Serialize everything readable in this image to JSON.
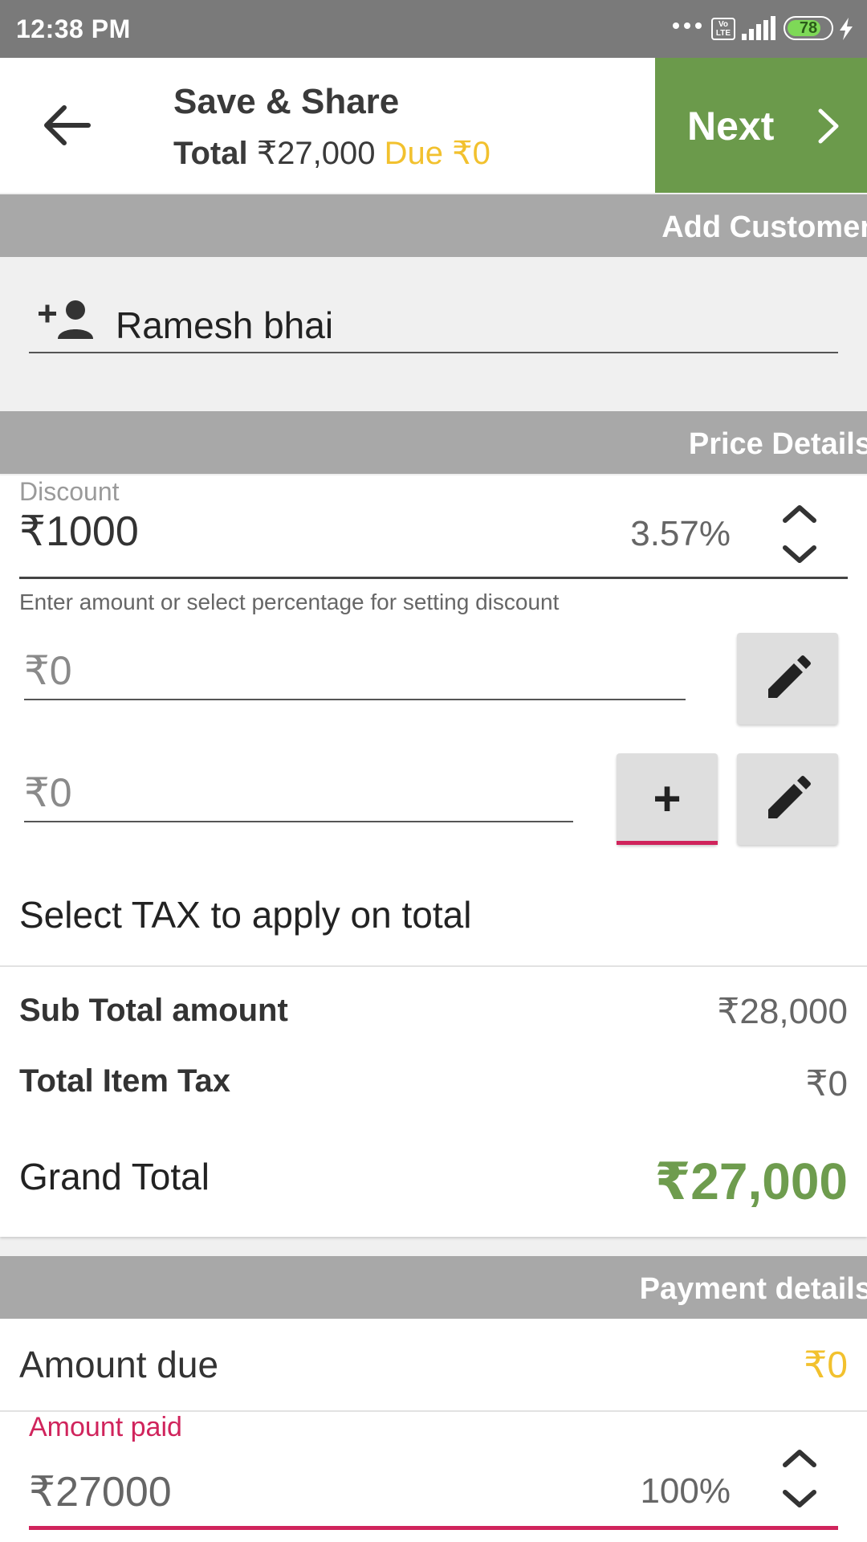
{
  "status_bar": {
    "time": "12:38 PM",
    "network_badge": "Vo LTE",
    "battery_level": "78",
    "battery_fraction": 0.78,
    "battery_color": "#7ed957"
  },
  "app_bar": {
    "back_icon": "arrow-back-icon",
    "title": "Save & Share",
    "total_label": "Total",
    "total_value": "₹27,000",
    "due_text": "Due ₹0",
    "next_label": "Next",
    "next_icon": "chevron-right-icon",
    "accent_color": "#6b9a4b",
    "due_color": "#f2c12e"
  },
  "customer_section": {
    "header": "Add Customer",
    "add_icon": "person-add-icon",
    "customer_name": "Ramesh bhai"
  },
  "price_section": {
    "header": "Price Details",
    "discount": {
      "label": "Discount",
      "value": "₹1000",
      "percent": "3.57%",
      "helper": "Enter amount or select percentage for setting discount"
    },
    "extra_charge_1": {
      "value": "₹0",
      "edit_icon": "pencil-icon"
    },
    "extra_charge_2": {
      "value": "₹0",
      "add_label": "+",
      "edit_icon": "pencil-icon"
    },
    "tax_prompt": "Select TAX to apply on total",
    "sub_total_label": "Sub Total amount",
    "sub_total_value": "₹28,000",
    "item_tax_label": "Total Item Tax",
    "item_tax_value": "₹0",
    "grand_total_label": "Grand Total",
    "grand_total_value": "₹27,000",
    "grand_total_color": "#6e9c4e"
  },
  "payment_section": {
    "header": "Payment details",
    "amount_due_label": "Amount due",
    "amount_due_value": "₹0",
    "amount_paid_label": "Amount paid",
    "amount_paid_value": "₹27000",
    "amount_paid_percent": "100%",
    "focus_color": "#d0245c"
  }
}
